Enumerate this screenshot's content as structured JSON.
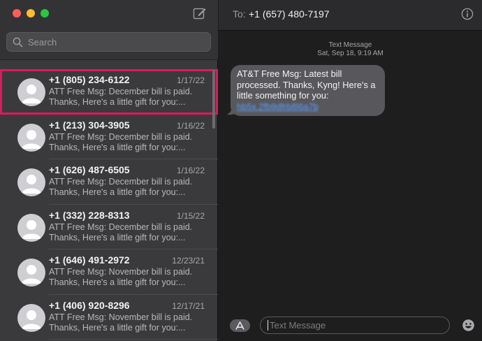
{
  "window": {
    "controls": [
      "close",
      "minimize",
      "zoom"
    ],
    "compose_icon": "compose-icon"
  },
  "sidebar": {
    "search_placeholder": "Search",
    "conversations": [
      {
        "name": "+1 (805) 234-6122",
        "date": "1/17/22",
        "line1": "ATT Free Msg: December bill is paid.",
        "line2": "Thanks,  Here's a little gift for you:...",
        "selected": true
      },
      {
        "name": "+1 (213) 304-3905",
        "date": "1/16/22",
        "line1": "ATT Free Msg: December bill is paid.",
        "line2": "Thanks,  Here's a little gift for you:..."
      },
      {
        "name": "+1 (626) 487-6505",
        "date": "1/16/22",
        "line1": "ATT Free Msg: December bill is paid.",
        "line2": "Thanks,  Here's a little gift for you:..."
      },
      {
        "name": "+1 (332) 228-8313",
        "date": "1/15/22",
        "line1": "ATT Free Msg: December bill is paid.",
        "line2": "Thanks,  Here's a little gift for you:..."
      },
      {
        "name": "+1 (646) 491-2972",
        "date": "12/23/21",
        "line1": "ATT Free Msg: November bill is paid.",
        "line2": "Thanks,  Here's a little gift for you:..."
      },
      {
        "name": "+1 (406) 920-8296",
        "date": "12/17/21",
        "line1": "ATT Free Msg: November bill is paid.",
        "line2": "Thanks,  Here's a little gift for you:..."
      }
    ]
  },
  "conversation": {
    "to_label": "To:",
    "to_value": "+1 (657) 480-7197",
    "info_icon": "info-icon",
    "timestamp_line1": "Text Message",
    "timestamp_line2": "Sat, Sep 18, 9:19 AM",
    "message_text": "AT&T Free Msg: Latest bill processed. Thanks, Kyng! Here's a little something for you:",
    "message_link": "hb5x.2fb9dfrb8l6a7b",
    "input_placeholder": "Text Message"
  },
  "colors": {
    "highlight": "#e0195a",
    "link": "#5aa1ff",
    "bubble": "#58585c"
  }
}
